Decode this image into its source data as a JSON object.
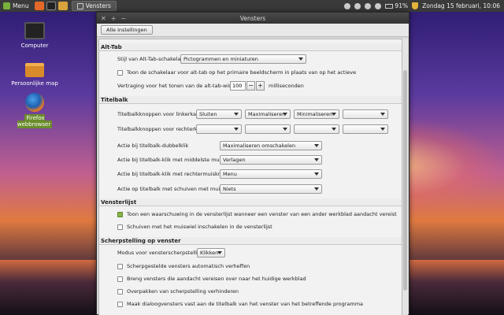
{
  "panel": {
    "menu_label": "Menu",
    "task_label": "Vensters",
    "battery": "91%",
    "datetime": "Zondag 15 februari, 10:06"
  },
  "desktop": {
    "icons": [
      {
        "label": "Computer"
      },
      {
        "label": "Persoonlijke map"
      },
      {
        "label": "Firefox webbrowser"
      }
    ]
  },
  "window": {
    "title": "Vensters",
    "controls": [
      "✕",
      "+",
      "−"
    ],
    "toolbar_button": "Alle instellingen"
  },
  "sections": {
    "alttab": {
      "title": "Alt-Tab",
      "style_label": "Stijl van Alt-Tab-schakelaar",
      "style_value": "Pictogrammen en miniaturen",
      "primary_label": "Toon de schakelaar voor alt-tab op het primaire beeldscherm in plaats van op het actieve",
      "delay_label": "Vertraging voor het tonen van de alt-tab-wisselaar",
      "delay_value": "100",
      "delay_minus": "−",
      "delay_plus": "+",
      "delay_unit": "milliseconden"
    },
    "titlebar": {
      "title": "Titelbalk",
      "left_label": "Titelbalkknoppen voor linkerkant",
      "left_values": [
        "Sluiten",
        "Maximaliseren",
        "Minimaliseren",
        ""
      ],
      "right_label": "Titelbalkknoppen voor rechterkant",
      "right_values": [
        "",
        "",
        "",
        ""
      ],
      "dbl_label": "Actie bij titelbalk-dubbelklik",
      "dbl_value": "Maximaliseren omschakelen",
      "middle_label": "Actie bij titelbalk-klik met middelste muisknop",
      "middle_value": "Verlagen",
      "right_click_label": "Actie bij titelbalk-klik met rechtermuisknop",
      "right_click_value": "Menu",
      "scroll_label": "Actie op titelbalk met schuiven met muis",
      "scroll_value": "Niets"
    },
    "windowlist": {
      "title": "Vensterlijst",
      "warn_label": "Toon een waarschuwing in de vensterlijst wanneer een venster van een ander werkblad aandacht vereist",
      "warn_checked": true,
      "wheel_label": "Schuiven met het muiswiel inschakelen in de vensterlijst",
      "wheel_checked": false
    },
    "focus": {
      "title": "Scherpstelling op venster",
      "mode_label": "Modus voor vensterscherpstelling",
      "mode_value": "Klikken",
      "opt1": "Scherpgestelde vensters automatisch verheffen",
      "opt2": "Breng vensters die aandacht vereisen over naar het huidige werkblad",
      "opt3": "Overpakken van scherpstelling verhinderen",
      "opt4": "Maak dialoogvensters vast aan de titelbalk van het venster van het betreffende programma"
    }
  }
}
